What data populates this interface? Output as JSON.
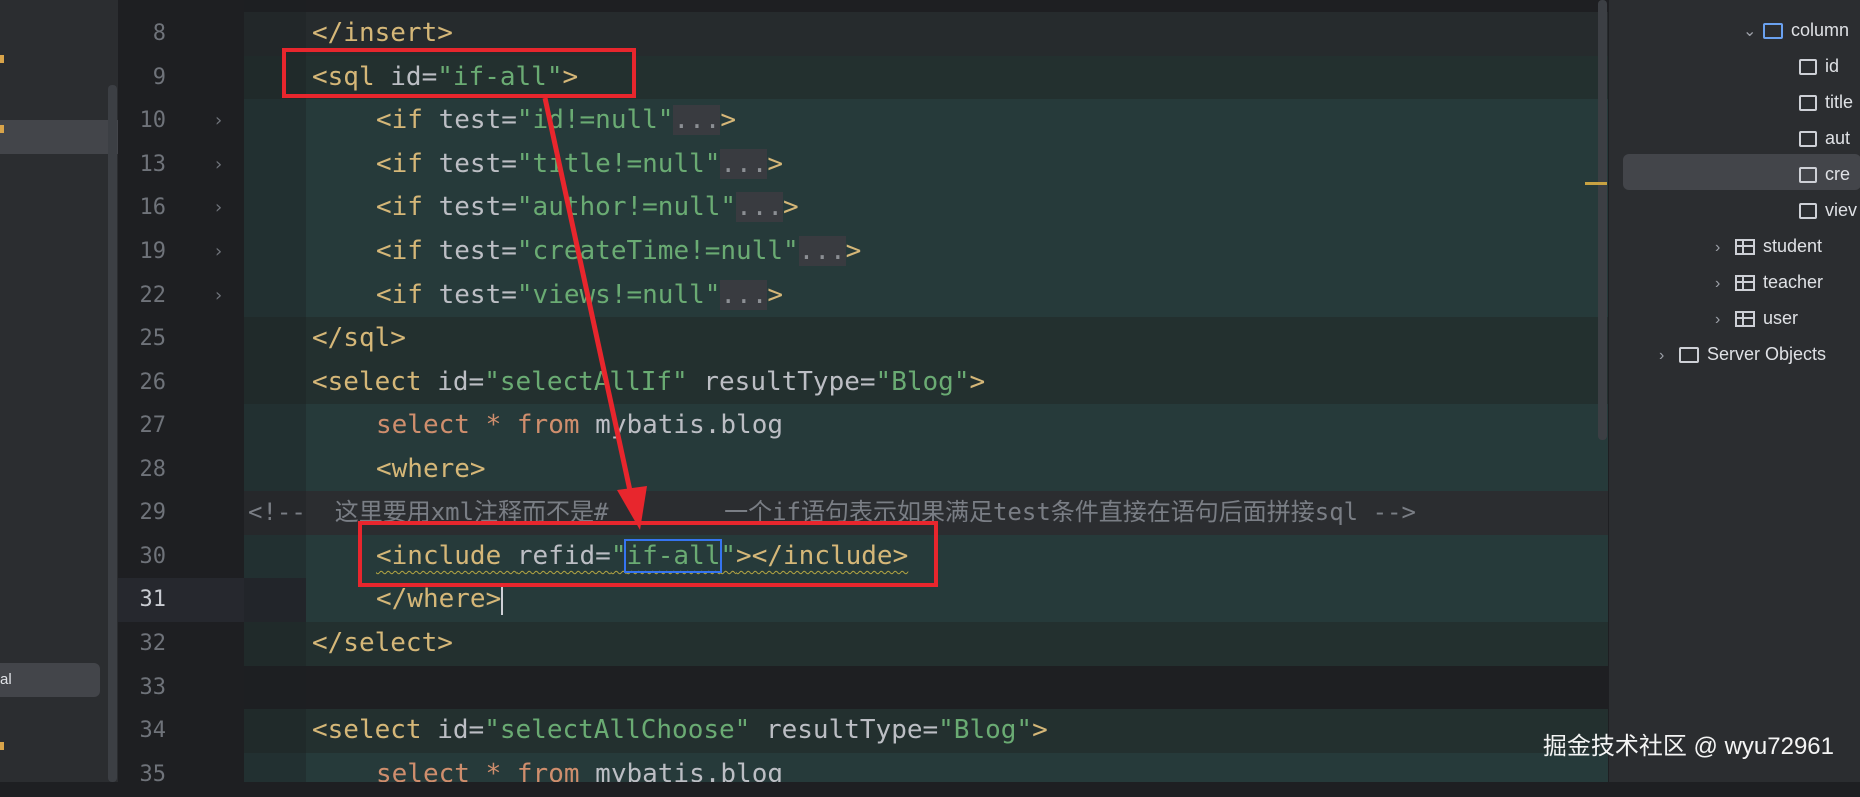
{
  "left_panel": {
    "partial_label": "al"
  },
  "gutter": {
    "lines": [
      "8",
      "9",
      "10",
      "13",
      "16",
      "19",
      "22",
      "25",
      "26",
      "27",
      "28",
      "29",
      "30",
      "31",
      "32",
      "33",
      "34",
      "35"
    ],
    "current_line": "31",
    "fold_chevron": "›"
  },
  "code": {
    "l8": {
      "tag": "</insert>"
    },
    "l9": {
      "open": "<sql ",
      "attr": "id=",
      "value": "\"if-all\"",
      "close": ">"
    },
    "l10": {
      "open": "<if ",
      "attr": "test=",
      "value": "\"id!=null\"",
      "fold": "...",
      "close": ">"
    },
    "l13": {
      "open": "<if ",
      "attr": "test=",
      "value": "\"title!=null\"",
      "fold": "...",
      "close": ">"
    },
    "l16": {
      "open": "<if ",
      "attr": "test=",
      "value": "\"author!=null\"",
      "fold": "...",
      "close": ">"
    },
    "l19": {
      "open": "<if ",
      "attr": "test=",
      "value": "\"createTime!=null\"",
      "fold": "...",
      "close": ">"
    },
    "l22": {
      "open": "<if ",
      "attr": "test=",
      "value": "\"views!=null\"",
      "fold": "...",
      "close": ">"
    },
    "l25": {
      "tag": "</sql>"
    },
    "l26": {
      "open": "<select ",
      "attr": "id=",
      "value": "\"selectAllIf\"",
      "attr2": " resultType=",
      "value2": "\"Blog\"",
      "close": ">"
    },
    "l27": {
      "kw1": "select",
      "star": " * ",
      "kw2": "from",
      "rest": " mybatis.blog"
    },
    "l28": {
      "tag": "<where>"
    },
    "l29": {
      "comment": "<!--  这里要用xml注释而不是#        一个if语句表示如果满足test条件直接在语句后面拼接sql -->"
    },
    "l30": {
      "open": "<include ",
      "attr": "refid=",
      "q1": "\"",
      "value": "if-all",
      "q2": "\"",
      "close": "></include>"
    },
    "l31": {
      "tag": "</where>"
    },
    "l32": {
      "tag": "</select>"
    },
    "l34": {
      "open": "<select ",
      "attr": "id=",
      "value": "\"selectAllChoose\"",
      "attr2": " resultType=",
      "value2": "\"Blog\"",
      "close": ">"
    },
    "l35": {
      "kw1": "select",
      "star": " * ",
      "kw2": "from",
      "rest": " mybatis.blog"
    }
  },
  "db_tree": {
    "columns_folder": "column",
    "columns": [
      "id",
      "title",
      "aut",
      "cre",
      "viev"
    ],
    "tables": [
      "student",
      "teacher",
      "user"
    ],
    "server_objects": "Server Objects"
  },
  "watermark": "掘金技术社区 @ wyu72961",
  "colors": {
    "highlight_red": "#e8262d",
    "tag": "#d5b778",
    "string": "#6aab73",
    "keyword": "#cf8e6d"
  }
}
